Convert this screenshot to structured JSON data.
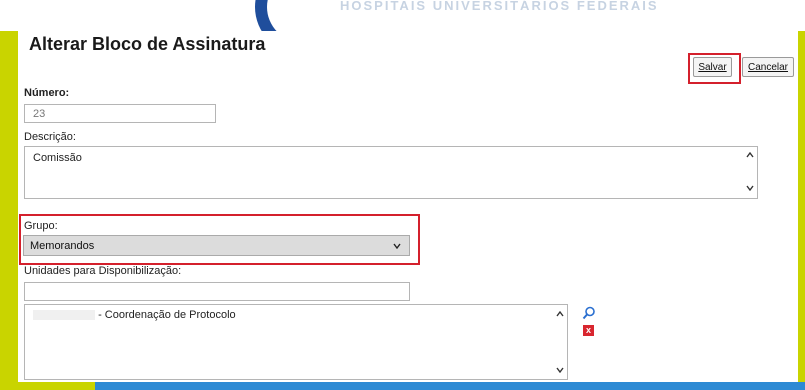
{
  "banner": {
    "text": "HOSPITAIS UNIVERSITÁRIOS FEDERAIS"
  },
  "page": {
    "title": "Alterar Bloco de Assinatura"
  },
  "toolbar": {
    "save_label": "Salvar",
    "cancel_label": "Cancelar"
  },
  "form": {
    "numero_label": "Número:",
    "numero_value": "23",
    "descricao_label": "Descrição:",
    "descricao_value": "Comissão",
    "grupo_label": "Grupo:",
    "grupo_value": "Memorandos",
    "unidades_label": "Unidades para Disponibilização:",
    "unidades_value": "",
    "unidades_list": [
      {
        "label": "- Coordenação de Protocolo"
      }
    ]
  },
  "icons": {
    "search": "magnifier-icon",
    "remove": "remove-x-icon",
    "remove_glyph": "x"
  },
  "colors": {
    "accent": "#c9d400",
    "highlight": "#d4202c",
    "brand_blue": "#1f4e9c"
  }
}
